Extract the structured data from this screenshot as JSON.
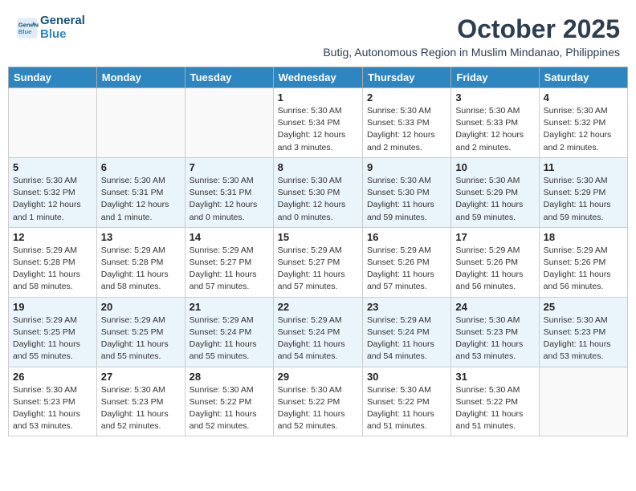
{
  "header": {
    "logo_line1": "General",
    "logo_line2": "Blue",
    "month": "October 2025",
    "location": "Butig, Autonomous Region in Muslim Mindanao, Philippines"
  },
  "weekdays": [
    "Sunday",
    "Monday",
    "Tuesday",
    "Wednesday",
    "Thursday",
    "Friday",
    "Saturday"
  ],
  "weeks": [
    [
      {
        "day": "",
        "info": ""
      },
      {
        "day": "",
        "info": ""
      },
      {
        "day": "",
        "info": ""
      },
      {
        "day": "1",
        "info": "Sunrise: 5:30 AM\nSunset: 5:34 PM\nDaylight: 12 hours and 3 minutes."
      },
      {
        "day": "2",
        "info": "Sunrise: 5:30 AM\nSunset: 5:33 PM\nDaylight: 12 hours and 2 minutes."
      },
      {
        "day": "3",
        "info": "Sunrise: 5:30 AM\nSunset: 5:33 PM\nDaylight: 12 hours and 2 minutes."
      },
      {
        "day": "4",
        "info": "Sunrise: 5:30 AM\nSunset: 5:32 PM\nDaylight: 12 hours and 2 minutes."
      }
    ],
    [
      {
        "day": "5",
        "info": "Sunrise: 5:30 AM\nSunset: 5:32 PM\nDaylight: 12 hours and 1 minute."
      },
      {
        "day": "6",
        "info": "Sunrise: 5:30 AM\nSunset: 5:31 PM\nDaylight: 12 hours and 1 minute."
      },
      {
        "day": "7",
        "info": "Sunrise: 5:30 AM\nSunset: 5:31 PM\nDaylight: 12 hours and 0 minutes."
      },
      {
        "day": "8",
        "info": "Sunrise: 5:30 AM\nSunset: 5:30 PM\nDaylight: 12 hours and 0 minutes."
      },
      {
        "day": "9",
        "info": "Sunrise: 5:30 AM\nSunset: 5:30 PM\nDaylight: 11 hours and 59 minutes."
      },
      {
        "day": "10",
        "info": "Sunrise: 5:30 AM\nSunset: 5:29 PM\nDaylight: 11 hours and 59 minutes."
      },
      {
        "day": "11",
        "info": "Sunrise: 5:30 AM\nSunset: 5:29 PM\nDaylight: 11 hours and 59 minutes."
      }
    ],
    [
      {
        "day": "12",
        "info": "Sunrise: 5:29 AM\nSunset: 5:28 PM\nDaylight: 11 hours and 58 minutes."
      },
      {
        "day": "13",
        "info": "Sunrise: 5:29 AM\nSunset: 5:28 PM\nDaylight: 11 hours and 58 minutes."
      },
      {
        "day": "14",
        "info": "Sunrise: 5:29 AM\nSunset: 5:27 PM\nDaylight: 11 hours and 57 minutes."
      },
      {
        "day": "15",
        "info": "Sunrise: 5:29 AM\nSunset: 5:27 PM\nDaylight: 11 hours and 57 minutes."
      },
      {
        "day": "16",
        "info": "Sunrise: 5:29 AM\nSunset: 5:26 PM\nDaylight: 11 hours and 57 minutes."
      },
      {
        "day": "17",
        "info": "Sunrise: 5:29 AM\nSunset: 5:26 PM\nDaylight: 11 hours and 56 minutes."
      },
      {
        "day": "18",
        "info": "Sunrise: 5:29 AM\nSunset: 5:26 PM\nDaylight: 11 hours and 56 minutes."
      }
    ],
    [
      {
        "day": "19",
        "info": "Sunrise: 5:29 AM\nSunset: 5:25 PM\nDaylight: 11 hours and 55 minutes."
      },
      {
        "day": "20",
        "info": "Sunrise: 5:29 AM\nSunset: 5:25 PM\nDaylight: 11 hours and 55 minutes."
      },
      {
        "day": "21",
        "info": "Sunrise: 5:29 AM\nSunset: 5:24 PM\nDaylight: 11 hours and 55 minutes."
      },
      {
        "day": "22",
        "info": "Sunrise: 5:29 AM\nSunset: 5:24 PM\nDaylight: 11 hours and 54 minutes."
      },
      {
        "day": "23",
        "info": "Sunrise: 5:29 AM\nSunset: 5:24 PM\nDaylight: 11 hours and 54 minutes."
      },
      {
        "day": "24",
        "info": "Sunrise: 5:30 AM\nSunset: 5:23 PM\nDaylight: 11 hours and 53 minutes."
      },
      {
        "day": "25",
        "info": "Sunrise: 5:30 AM\nSunset: 5:23 PM\nDaylight: 11 hours and 53 minutes."
      }
    ],
    [
      {
        "day": "26",
        "info": "Sunrise: 5:30 AM\nSunset: 5:23 PM\nDaylight: 11 hours and 53 minutes."
      },
      {
        "day": "27",
        "info": "Sunrise: 5:30 AM\nSunset: 5:23 PM\nDaylight: 11 hours and 52 minutes."
      },
      {
        "day": "28",
        "info": "Sunrise: 5:30 AM\nSunset: 5:22 PM\nDaylight: 11 hours and 52 minutes."
      },
      {
        "day": "29",
        "info": "Sunrise: 5:30 AM\nSunset: 5:22 PM\nDaylight: 11 hours and 52 minutes."
      },
      {
        "day": "30",
        "info": "Sunrise: 5:30 AM\nSunset: 5:22 PM\nDaylight: 11 hours and 51 minutes."
      },
      {
        "day": "31",
        "info": "Sunrise: 5:30 AM\nSunset: 5:22 PM\nDaylight: 11 hours and 51 minutes."
      },
      {
        "day": "",
        "info": ""
      }
    ]
  ]
}
